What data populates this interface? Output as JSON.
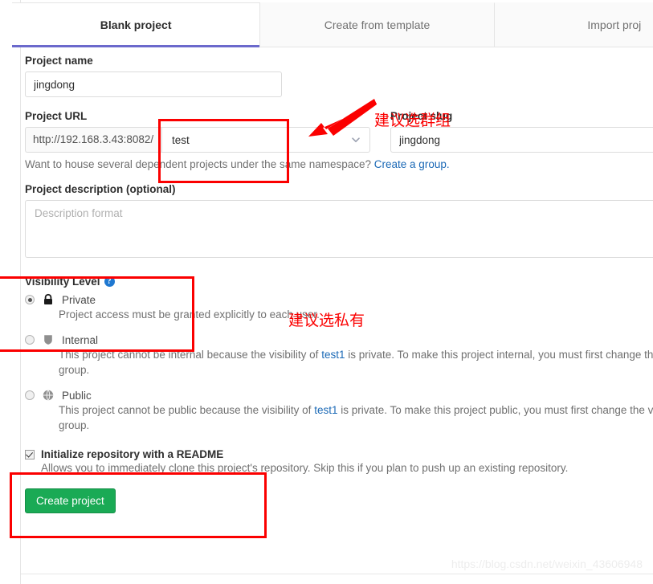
{
  "tabs": [
    {
      "label": "Blank project",
      "active": true
    },
    {
      "label": "Create from template",
      "active": false
    },
    {
      "label": "Import proj",
      "active": false
    }
  ],
  "form": {
    "project_name": {
      "label": "Project name",
      "value": "jingdong",
      "placeholder": ""
    },
    "project_url": {
      "label": "Project URL",
      "prefix": "http://192.168.3.43:8082/",
      "namespace": "test",
      "chevron": "chevron-down-icon"
    },
    "project_slug": {
      "label": "Project slug",
      "value": "jingdong",
      "placeholder": ""
    },
    "namespace_helper": {
      "text": "Want to house several dependent projects under the same namespace? ",
      "link": "Create a group."
    },
    "project_description": {
      "label": "Project description (optional)",
      "placeholder": "Description format",
      "value": ""
    }
  },
  "visibility": {
    "title": "Visibility Level",
    "help_icon": "?",
    "options": [
      {
        "name": "Private",
        "icon": "lock-icon",
        "selected": true,
        "description_pre": "Project access must be granted explicitly to each user.",
        "link": "",
        "description_post": "",
        "description_line2": ""
      },
      {
        "name": "Internal",
        "icon": "shield-icon",
        "selected": false,
        "description_pre": "This project cannot be internal because the visibility of ",
        "link": "test1",
        "description_post": " is private. To make this project internal, you must first change the visibility of",
        "description_line2": "the parent group."
      },
      {
        "name": "Public",
        "icon": "globe-icon",
        "selected": false,
        "description_pre": "This project cannot be public because the visibility of ",
        "link": "test1",
        "description_post": " is private. To make this project public, you must first change the visibility of",
        "description_line2": "the parent group."
      }
    ]
  },
  "readme": {
    "label": "Initialize repository with a README",
    "checked": true,
    "description": "Allows you to immediately clone this project's repository. Skip this if you plan to push up an existing repository."
  },
  "create_button": {
    "label": "Create project"
  },
  "annotations": {
    "arrow_note": "建议选群组",
    "visibility_note": "建议选私有",
    "color": "#fb0000"
  },
  "watermark": {
    "text": "https://blog.csdn.net/weixin_43606948"
  }
}
